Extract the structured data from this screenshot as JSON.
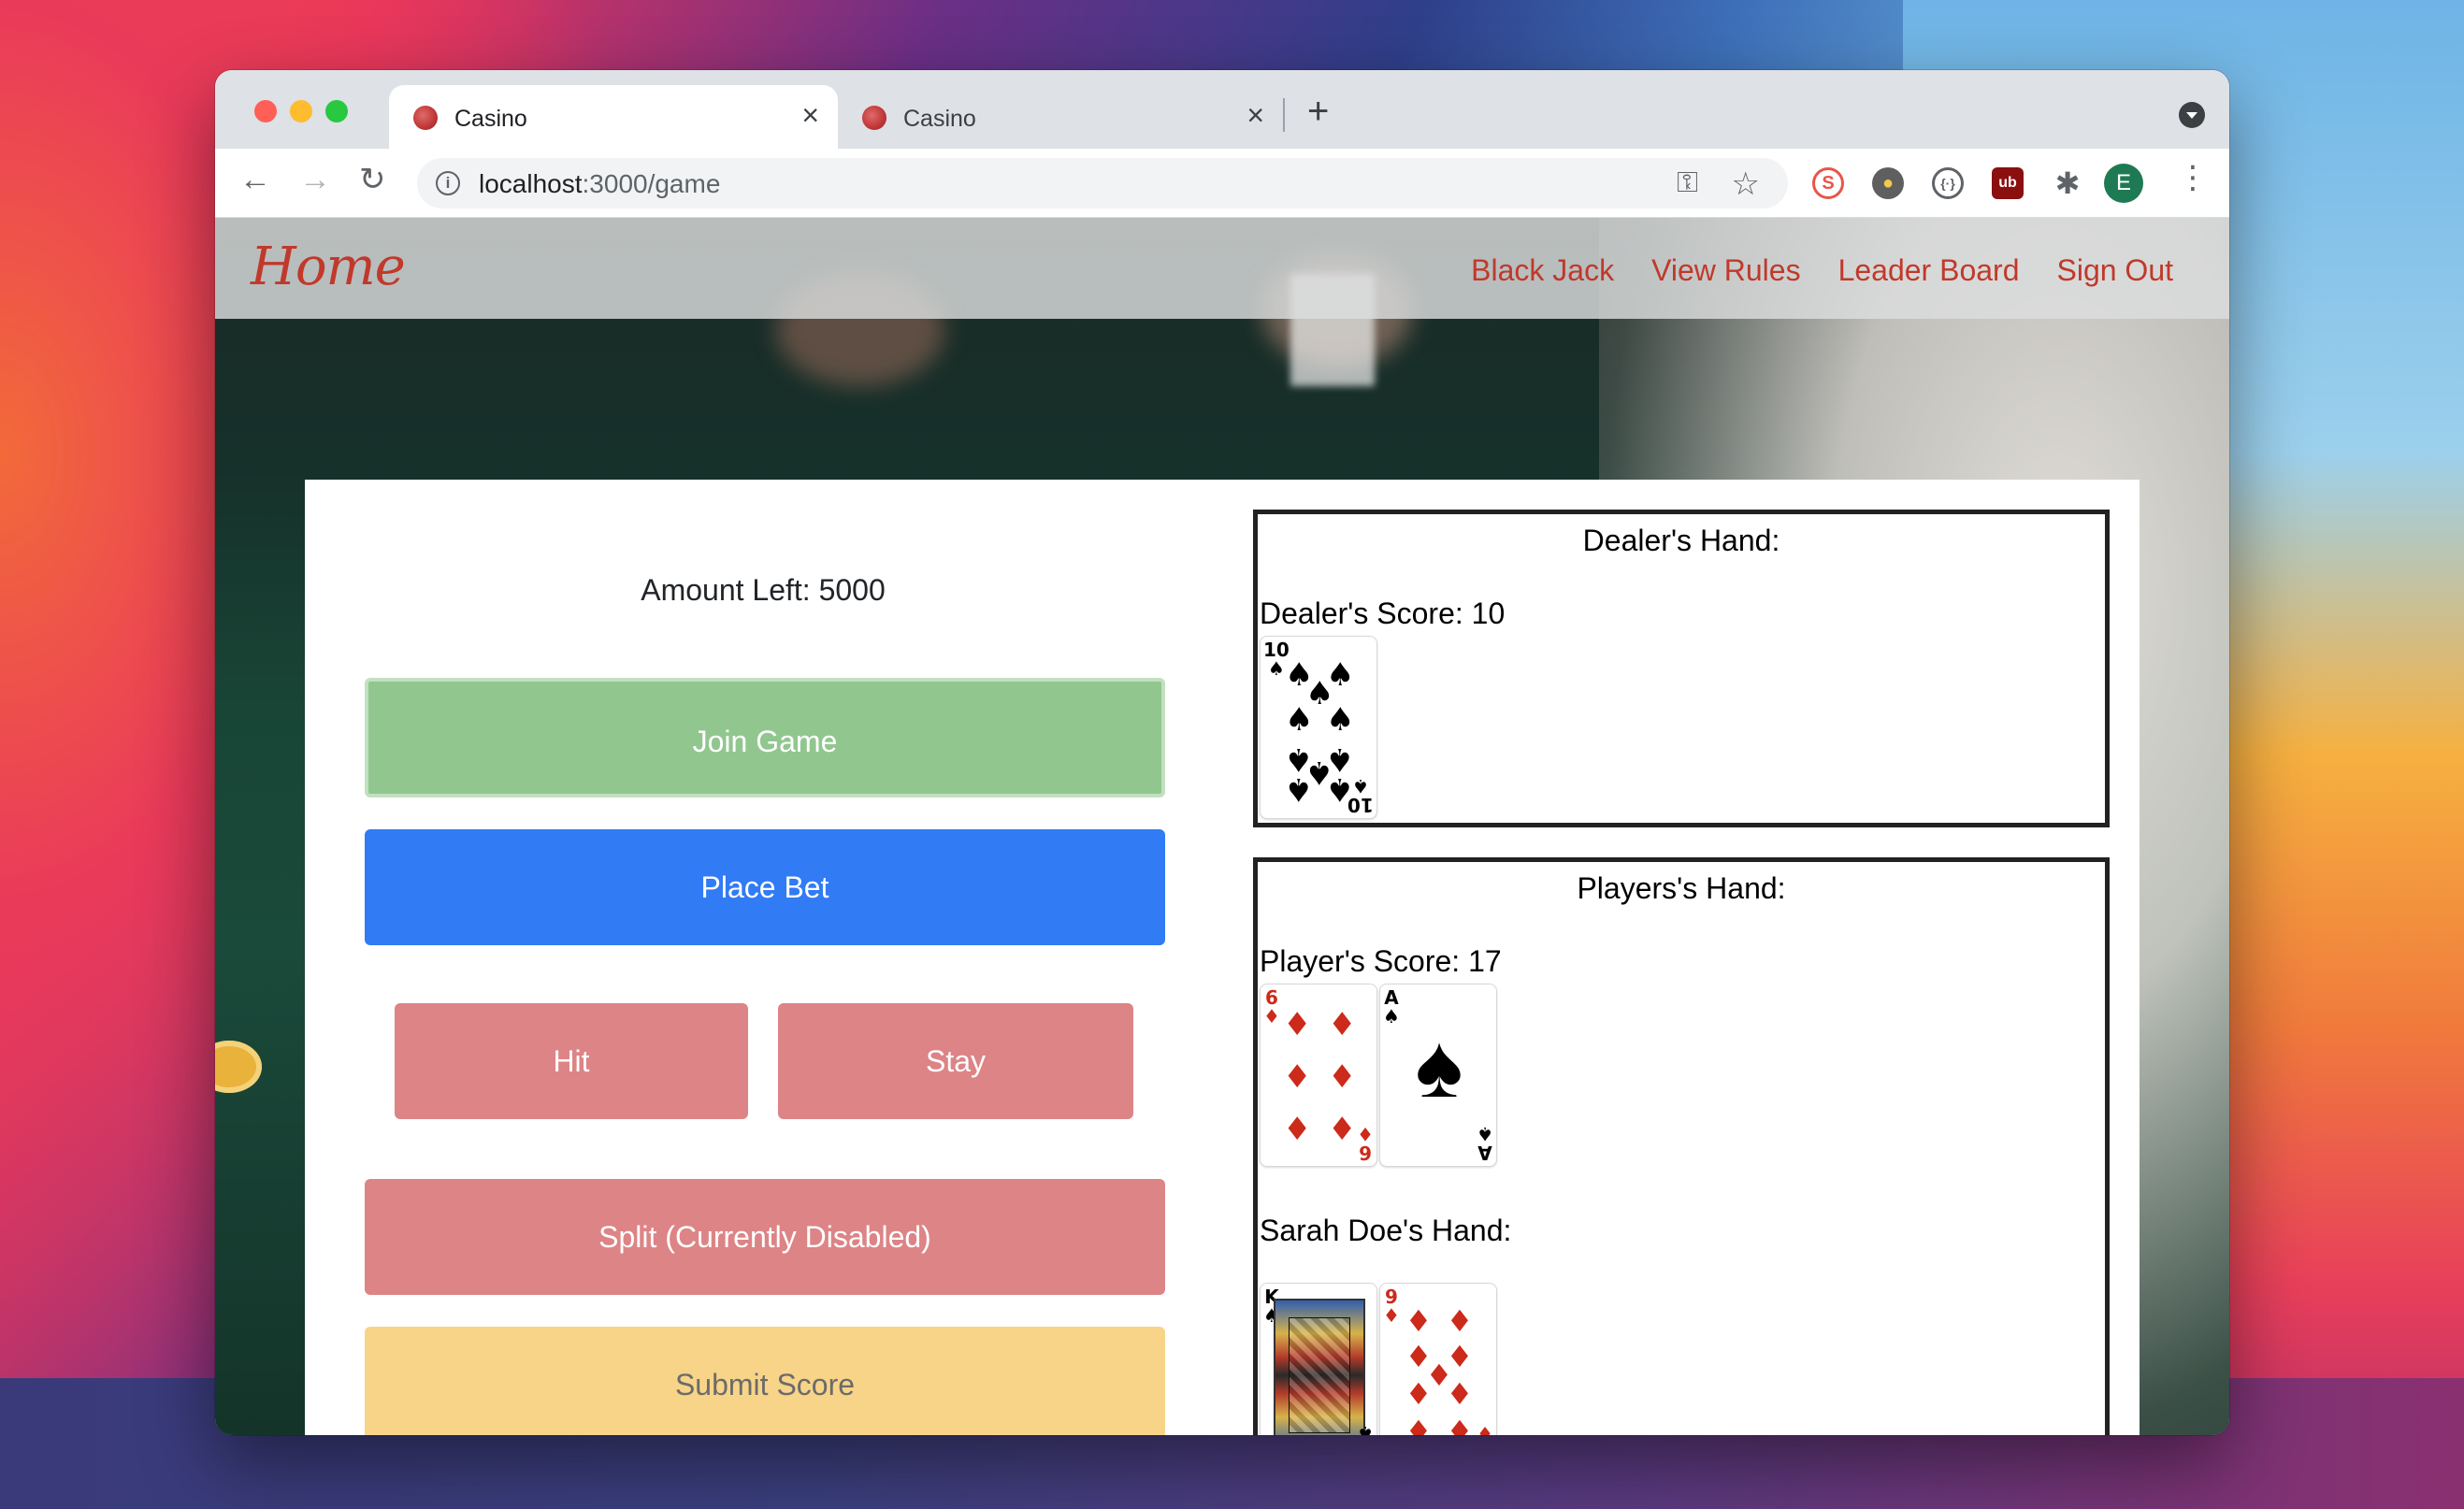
{
  "browser": {
    "tabs": [
      {
        "title": "Casino",
        "active": true
      },
      {
        "title": "Casino",
        "active": false
      }
    ],
    "new_tab_label": "+",
    "close_label": "×",
    "url_host": "localhost",
    "url_path": ":3000/game",
    "profile_initial": "E"
  },
  "navbar": {
    "brand": "Home",
    "links": [
      "Black Jack",
      "View Rules",
      "Leader Board",
      "Sign Out"
    ]
  },
  "game": {
    "amount_left": "Amount Left: 5000",
    "buttons": {
      "join": "Join Game",
      "bet": "Place Bet",
      "hit": "Hit",
      "stay": "Stay",
      "split": "Split (Currently Disabled)",
      "submit": "Submit Score"
    },
    "dealer": {
      "title": "Dealer's Hand:",
      "score": "Dealer's Score: 10",
      "cards": [
        {
          "rank": "10",
          "suit": "♠",
          "color": "black"
        }
      ]
    },
    "players": {
      "title": "Players's Hand:",
      "score": "Player's Score: 17",
      "cards": [
        {
          "rank": "6",
          "suit": "♦",
          "color": "red"
        },
        {
          "rank": "A",
          "suit": "♠",
          "color": "black"
        }
      ],
      "other_hand_title": "Sarah Doe's Hand:",
      "other_cards": [
        {
          "rank": "K",
          "suit": "♠",
          "color": "black"
        },
        {
          "rank": "9",
          "suit": "♦",
          "color": "red"
        }
      ]
    }
  },
  "colors": {
    "brand": "#c0392b",
    "join": "#91c78f",
    "bet": "#317bf5",
    "danger_soft": "#dd8486",
    "warning_soft": "#f8d488"
  }
}
